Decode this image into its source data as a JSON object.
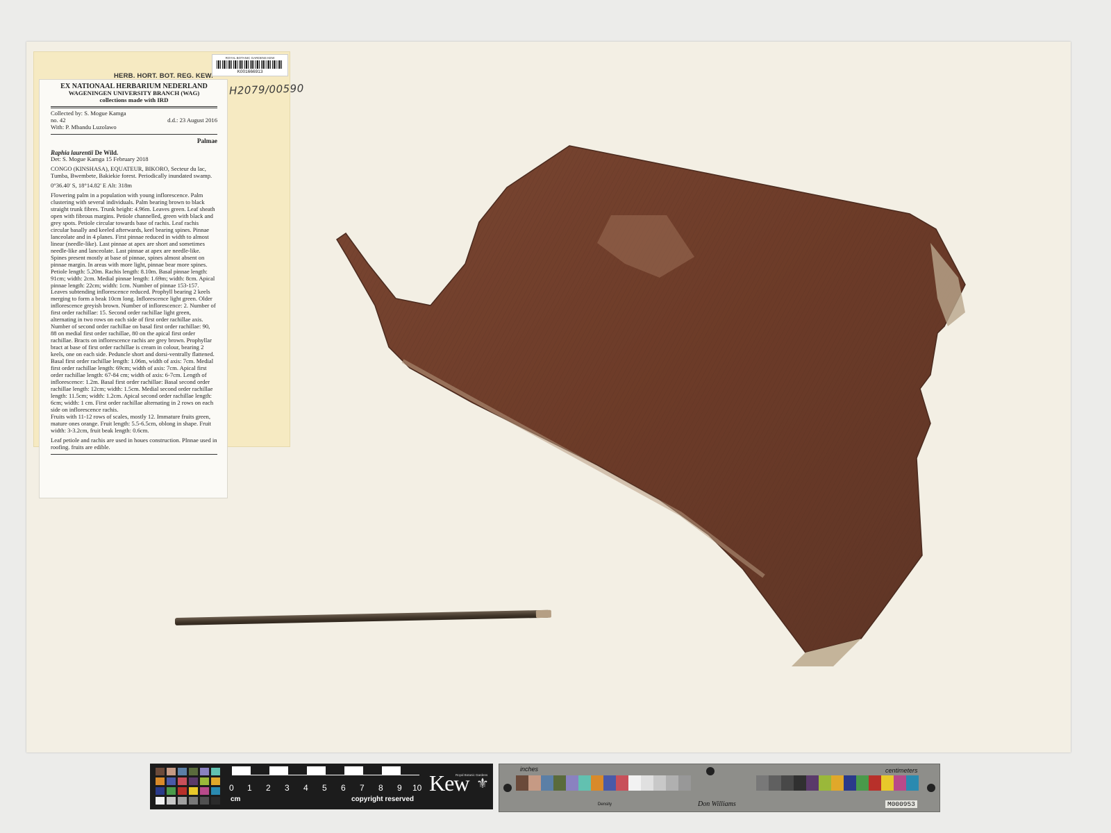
{
  "barcode": {
    "org": "ROYAL BOTANIC GARDENS KEW",
    "number": "K001666913"
  },
  "herb_header": "HERB. HORT. BOT. REG. KEW.",
  "hand_number": "H2079/00590",
  "label": {
    "institution_1": "EX NATIONAAL HERBARIUM NEDERLAND",
    "institution_2": "WAGENINGEN UNIVERSITY BRANCH (WAG)",
    "institution_3": "collections made with IRD",
    "collected_by": "Collected by: S. Mogue Kamga",
    "number": "no.  42",
    "date": "d.d.: 23 August 2016",
    "with": "With: P. Mbandu Luzolawo",
    "family": "Palmae",
    "taxon_italic": "Raphia laurentii",
    "taxon_author": " De Wild.",
    "det": "Det: S. Mogue Kamga   15 February 2018",
    "locality": "CONGO (KINSHASA), EQUATEUR, BIKORO, Secteur du lac, Tumba, Bwembete, Bakiekie forest.  Periodically inundated swamp.",
    "coords": "0°36.40' S,  18°14.82' E Alt: 318m",
    "desc_1": "Flowering palm in a population with young inflorescence. Palm clustering with several individuals. Palm bearing brown to black straight trunk fibres.  Trunk height: 4.96m. Leaves green. Leaf sheath open with fibrous margins. Petiole channelled, green with black and grey spots. Petiole circular towards base of rachis. Leaf rachis circular basally and keeled afterwards, keel bearing spines. Pinnae lanceolate and in 4 planes. First pinnae reduced in width to almost linear (needle-like). Last pinnae at apex are short and sometimes needle-like and lanceolate. Last pinnae at apex are needle-like. Spines present mostly at base of pinnae, spines almost absent on pinnae margin. In areas with more light, pinnae bear more spines. Petiole length: 5.20m. Rachis length: 8.10m. Basal pinnae length: 91cm; width: 2cm. Medial pinnae length: 1.69m; width: 8cm. Apical pinnae length: 22cm; width: 1cm. Number of pinnae 153-157.",
    "desc_2": "Leaves subtending inflorescence reduced. Prophyll bearing 2 keels merging to form a beak 10cm long. Inflorescence light green. Older inflorescence greyish brown. Number of inflorescence: 2. Number of first order rachillae: 15. Second order rachillae light green, alternating in two rows on each side of first order rachillae axis. Number of second order rachillae on basal first order rachillae: 90, 88 on medial first order rachillae, 80 on the apical first order rachillae. Bracts on inflorescence rachis are grey brown. Prophyllar bract at base of first order rachillae is cream in colour, bearing 2 keels, one on each side. Peduncle short and dorsi-ventrally flattened. Basal first order rachillae length: 1.06m, width of axis: 7cm. Medial first order rachillae length: 69cm; width of axis: 7cm. Apical first order rachillae length: 67-84 cm; width of axis: 6-7cm. Length of inflorescence: 1.2m. Basal first order rachillae: Basal second order rachillae length: 12cm; width: 1.5cm. Medial second order rachillae length: 11.5cm; width: 1.2cm. Apical second order rachillae length: 6cm; width: 1 cm. First order rachillae alternating in 2 rows on each side on inflorescence rachis.",
    "desc_3": "Fruits with 11-12 rows of scales, mostly 12. Immature fruits green, mature ones orange. Fruit length: 5.5-6.5cm, oblong in shape. Fruit width: 3-3.2cm, fruit beak length: 0.6cm.",
    "desc_4": "Leaf petiole and rachis are used in houes construction. PInnae used in roofing. fruits are edible."
  },
  "scale_bar": {
    "numbers": [
      "0",
      "1",
      "2",
      "3",
      "4",
      "5",
      "6",
      "7",
      "8",
      "9",
      "10"
    ],
    "unit": "cm",
    "copyright": "copyright reserved",
    "logo": "Kew",
    "logo_sub": "Royal Botanic Gardens"
  },
  "color_card": {
    "inches_label": "inches",
    "cm_label": "centimeters",
    "density_label": "Density",
    "signature": "Don Williams",
    "code": "M000953"
  },
  "colors": {
    "sheet": "#f3efe4",
    "leaf": "#6e3d2a",
    "label_backing": "#f6eac2"
  }
}
